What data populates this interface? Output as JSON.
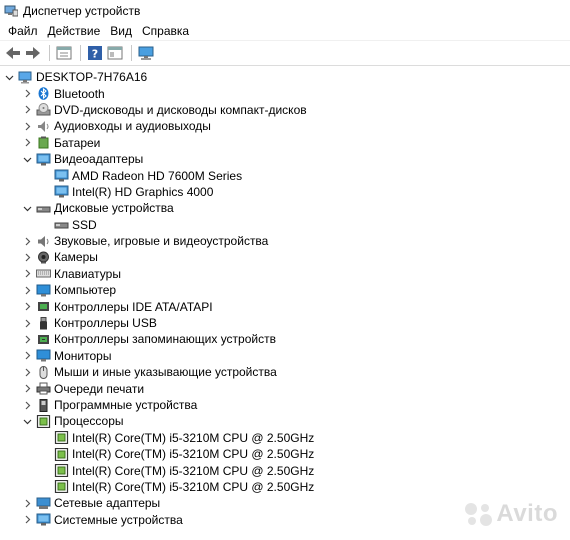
{
  "window": {
    "title": "Диспетчер устройств"
  },
  "menu": [
    {
      "label": "Файл"
    },
    {
      "label": "Действие"
    },
    {
      "label": "Вид"
    },
    {
      "label": "Справка"
    }
  ],
  "toolbar": [
    "back-icon",
    "forward-icon",
    "properties-icon",
    "help-icon",
    "view-icon",
    "monitor-scan-icon"
  ],
  "tree": [
    {
      "label": "DESKTOP-7H76A16",
      "level": 0,
      "exp": "open",
      "icon": "computer"
    },
    {
      "label": "Bluetooth",
      "level": 1,
      "exp": "closed",
      "icon": "bluetooth"
    },
    {
      "label": "DVD-дисководы и дисководы компакт-дисков",
      "level": 1,
      "exp": "closed",
      "icon": "dvd"
    },
    {
      "label": "Аудиовходы и аудиовыходы",
      "level": 1,
      "exp": "closed",
      "icon": "audio"
    },
    {
      "label": "Батареи",
      "level": 1,
      "exp": "closed",
      "icon": "battery"
    },
    {
      "label": "Видеоадаптеры",
      "level": 1,
      "exp": "open",
      "icon": "display"
    },
    {
      "label": "AMD Radeon HD 7600M Series",
      "level": 2,
      "exp": "none",
      "icon": "display"
    },
    {
      "label": "Intel(R) HD Graphics 4000",
      "level": 2,
      "exp": "none",
      "icon": "display"
    },
    {
      "label": "Дисковые устройства",
      "level": 1,
      "exp": "open",
      "icon": "disk"
    },
    {
      "label": "SSD",
      "level": 2,
      "exp": "none",
      "icon": "disk"
    },
    {
      "label": "Звуковые, игровые и видеоустройства",
      "level": 1,
      "exp": "closed",
      "icon": "speaker"
    },
    {
      "label": "Камеры",
      "level": 1,
      "exp": "closed",
      "icon": "camera"
    },
    {
      "label": "Клавиатуры",
      "level": 1,
      "exp": "closed",
      "icon": "keyboard"
    },
    {
      "label": "Компьютер",
      "level": 1,
      "exp": "closed",
      "icon": "monitor"
    },
    {
      "label": "Контроллеры IDE ATA/ATAPI",
      "level": 1,
      "exp": "closed",
      "icon": "ide"
    },
    {
      "label": "Контроллеры USB",
      "level": 1,
      "exp": "closed",
      "icon": "usb"
    },
    {
      "label": "Контроллеры запоминающих устройств",
      "level": 1,
      "exp": "closed",
      "icon": "storage"
    },
    {
      "label": "Мониторы",
      "level": 1,
      "exp": "closed",
      "icon": "monitor"
    },
    {
      "label": "Мыши и иные указывающие устройства",
      "level": 1,
      "exp": "closed",
      "icon": "mouse"
    },
    {
      "label": "Очереди печати",
      "level": 1,
      "exp": "closed",
      "icon": "printer"
    },
    {
      "label": "Программные устройства",
      "level": 1,
      "exp": "closed",
      "icon": "software"
    },
    {
      "label": "Процессоры",
      "level": 1,
      "exp": "open",
      "icon": "cpu"
    },
    {
      "label": "Intel(R) Core(TM) i5-3210M CPU @ 2.50GHz",
      "level": 2,
      "exp": "none",
      "icon": "cpu"
    },
    {
      "label": "Intel(R) Core(TM) i5-3210M CPU @ 2.50GHz",
      "level": 2,
      "exp": "none",
      "icon": "cpu"
    },
    {
      "label": "Intel(R) Core(TM) i5-3210M CPU @ 2.50GHz",
      "level": 2,
      "exp": "none",
      "icon": "cpu"
    },
    {
      "label": "Intel(R) Core(TM) i5-3210M CPU @ 2.50GHz",
      "level": 2,
      "exp": "none",
      "icon": "cpu"
    },
    {
      "label": "Сетевые адаптеры",
      "level": 1,
      "exp": "closed",
      "icon": "network"
    },
    {
      "label": "Системные устройства",
      "level": 1,
      "exp": "closed",
      "icon": "system"
    }
  ],
  "watermark": {
    "text": "Avito"
  }
}
